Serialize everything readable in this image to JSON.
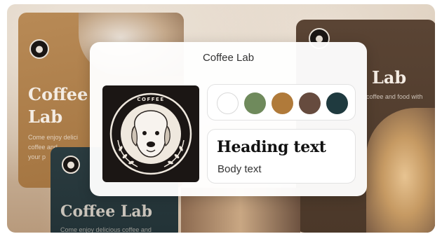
{
  "panel": {
    "title": "Coffee Lab",
    "logo": {
      "text": "COFFEE",
      "icon": "dog-icon"
    },
    "palette": [
      "#ffffff",
      "#6f8a5c",
      "#b07a3a",
      "#664b3e",
      "#1f3a3f"
    ],
    "typography": {
      "heading": "Heading text",
      "body": "Body text"
    }
  },
  "background": {
    "left_card": {
      "title_line1": "Coffee",
      "title_line2": "Lab",
      "desc_line1": "Come enjoy delici",
      "desc_line2": "coffee and",
      "desc_line3": "your p"
    },
    "right_card": {
      "title": "Lab",
      "desc": "coffee and food with"
    },
    "bottom_card": {
      "title": "Coffee Lab",
      "desc": "Come enjoy delicious coffee and"
    }
  }
}
